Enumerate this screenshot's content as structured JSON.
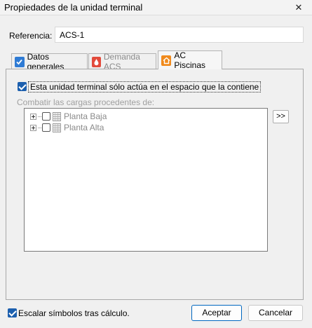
{
  "window": {
    "title": "Propiedades de la unidad terminal",
    "close_glyph": "✕"
  },
  "referencia": {
    "label": "Referencia:",
    "value": "ACS-1"
  },
  "tabs": [
    {
      "label": "Datos generales",
      "icon": "checkbox-tab-icon",
      "icon_color": "#2f7bd4"
    },
    {
      "label": "Demanda ACS",
      "icon": "water-drop-icon",
      "icon_color": "#e24a3b"
    },
    {
      "label": "AC Piscinas",
      "icon": "home-icon",
      "icon_color": "#f08a1c",
      "selected": true
    }
  ],
  "panel": {
    "only_space_checkbox": {
      "label": "Esta unidad terminal sólo actúa en el espacio que la contiene",
      "checked": true
    },
    "combat_label": "Combatir las cargas procedentes de:",
    "tree_items": [
      {
        "label": "Planta Baja",
        "checked": false
      },
      {
        "label": "Planta Alta",
        "checked": false
      }
    ],
    "add_button": ">>"
  },
  "footer": {
    "scale_checkbox": {
      "label": "Escalar símbolos tras cálculo.",
      "checked": true
    },
    "accept": "Aceptar",
    "cancel": "Cancelar"
  },
  "colors": {
    "accent": "#1c5fae",
    "default_button_border": "#0067c0"
  }
}
